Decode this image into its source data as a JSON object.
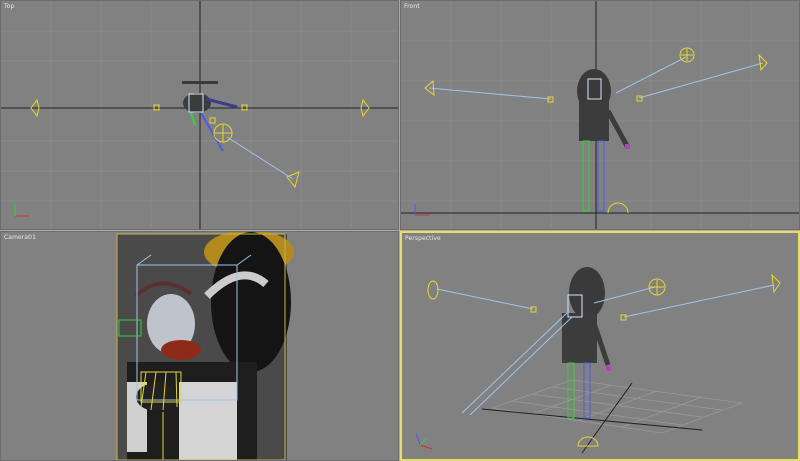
{
  "viewports": {
    "top": {
      "label": "Top"
    },
    "front": {
      "label": "Front"
    },
    "camera": {
      "label": "Camera01"
    },
    "perspective": {
      "label": "Perspective"
    }
  },
  "colors": {
    "background": "#818181",
    "grid_line": "#8a8a8a",
    "axis_line": "#1e1e1e",
    "active_border": "#e6dd6a",
    "light": "#e8d82a",
    "target_line": "#9ec4ee",
    "bone_green": "#34d23a",
    "bone_blue": "#4a5be6",
    "bone_yellow": "#e3d537"
  },
  "icons": {
    "top_gizmo": "axis-gizmo-icon",
    "front_gizmo": "axis-gizmo-icon",
    "perspective_gizmo": "axis-gizmo-icon"
  }
}
